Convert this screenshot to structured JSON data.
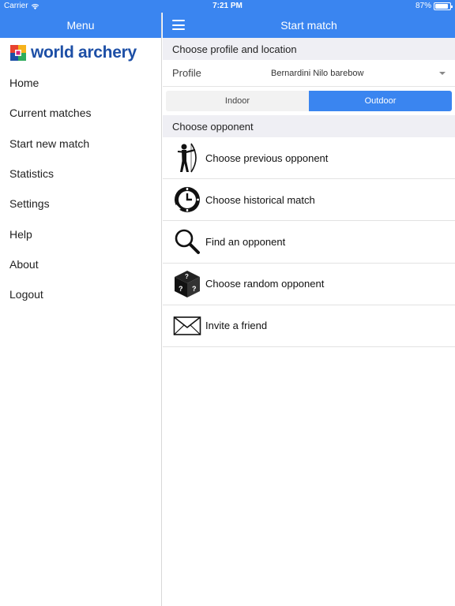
{
  "status_bar": {
    "carrier": "Carrier",
    "time": "7:21 PM",
    "battery": "87%",
    "battery_level": 0.87
  },
  "sidebar": {
    "title": "Menu",
    "logo_text": "world archery",
    "items": [
      {
        "label": "Home"
      },
      {
        "label": "Current matches"
      },
      {
        "label": "Start new match"
      },
      {
        "label": "Statistics"
      },
      {
        "label": "Settings"
      },
      {
        "label": "Help"
      },
      {
        "label": "About"
      },
      {
        "label": "Logout"
      }
    ]
  },
  "main": {
    "title": "Start match",
    "profile_section": {
      "header": "Choose profile and location",
      "profile_label": "Profile",
      "profile_value": "Bernardini Nilo barebow",
      "segments": [
        {
          "label": "Indoor",
          "selected": false
        },
        {
          "label": "Outdoor",
          "selected": true
        }
      ]
    },
    "opponent_section": {
      "header": "Choose opponent",
      "options": [
        {
          "label": "Choose previous opponent",
          "icon": "archer-icon"
        },
        {
          "label": "Choose historical match",
          "icon": "history-icon"
        },
        {
          "label": "Find an opponent",
          "icon": "magnifier-icon"
        },
        {
          "label": "Choose random opponent",
          "icon": "dice-icon"
        },
        {
          "label": "Invite a friend",
          "icon": "envelope-icon"
        }
      ]
    }
  },
  "colors": {
    "accent": "#3a85f0",
    "logo_blue": "#1d4fa6",
    "section_bg": "#efeff4"
  }
}
